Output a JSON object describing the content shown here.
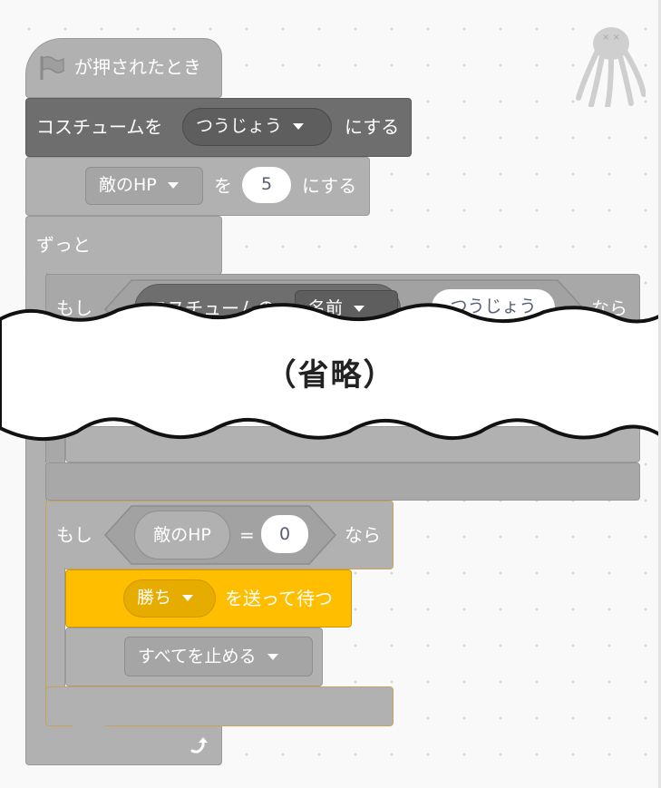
{
  "script": {
    "hat": {
      "label": "が押されたとき",
      "icon": "green-flag-icon"
    },
    "costume_block": {
      "prefix": "コスチュームを",
      "value": "つうじょう",
      "suffix": "にする"
    },
    "var_block": {
      "var": "敵のHP",
      "mid": "を",
      "value": "5",
      "suffix": "にする"
    },
    "forever": {
      "label": "ずっと",
      "loop_icon": "loop-arrow-icon"
    },
    "if1": {
      "prefix": "もし",
      "reporter": "コスチュームの",
      "menu": "名前",
      "op": "=",
      "value": "つうじょう",
      "suffix": "なら"
    },
    "omitted_label": "（省略）",
    "if2": {
      "prefix": "もし",
      "reporter": "敵のHP",
      "op": "=",
      "value": "0",
      "suffix": "なら"
    },
    "broadcast": {
      "message": "勝ち",
      "suffix": "を送って待つ"
    },
    "stop": {
      "option": "すべてを止める"
    }
  },
  "colors": {
    "block_gray": "#b1b1b1",
    "block_dark": "#6e6e6e",
    "event_yellow": "#ffbf00"
  }
}
